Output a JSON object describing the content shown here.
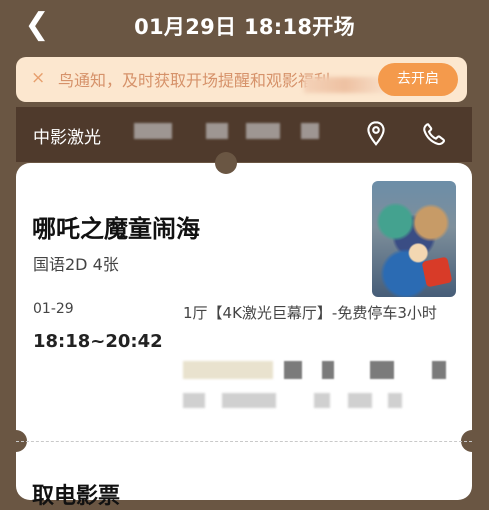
{
  "header": {
    "title": "01月29日 18:18开场"
  },
  "notice": {
    "text": "鸟通知，及时获取开场提醒和观影福利",
    "action_label": "去开启",
    "close_icon": "×"
  },
  "cinema": {
    "name": "中影激光",
    "location_icon": "location-icon",
    "phone_icon": "phone-icon"
  },
  "ticket": {
    "movie_title": "哪吒之魔童闹海",
    "meta": "国语2D 4张",
    "date": "01-29",
    "time": "18:18~20:42",
    "hall": "1厅【4K激光巨幕厅】-免费停车3小时"
  },
  "section_title": "取电影票",
  "colors": {
    "background": "#6a5643",
    "notice_bg": "#fce7cf",
    "accent": "#f49a4c",
    "cinema_bar": "#4f3a2c"
  }
}
